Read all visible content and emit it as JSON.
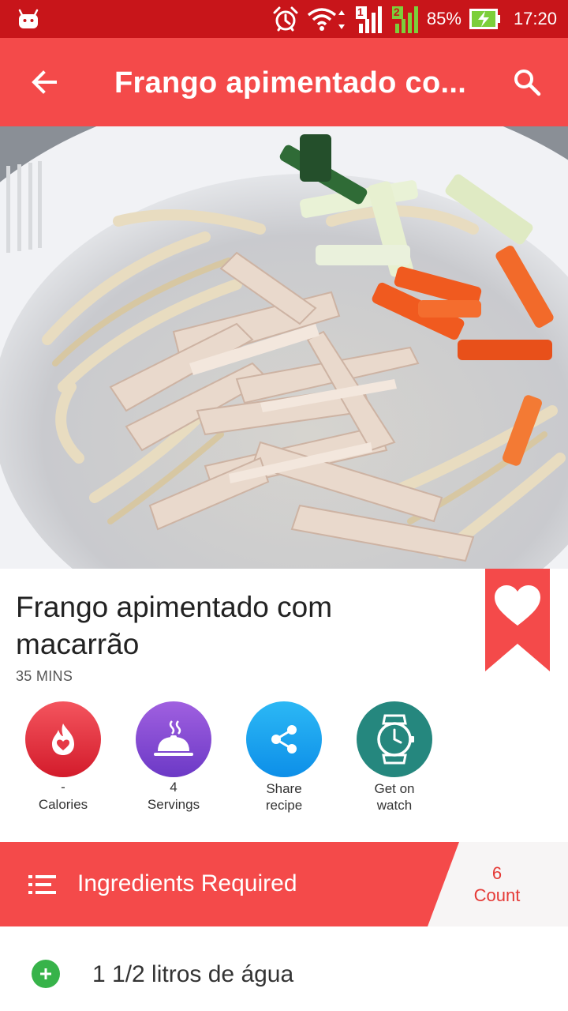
{
  "status_bar": {
    "battery": "85%",
    "time": "17:20",
    "sim1": "1",
    "sim2": "2"
  },
  "app_bar": {
    "title": "Frango apimentado co...",
    "back_icon": "arrow-back-icon",
    "search_icon": "search-icon"
  },
  "recipe": {
    "title": "Frango apimentado com macarrão",
    "time": "35 MINS",
    "favorite_icon": "heart-icon"
  },
  "info": [
    {
      "icon": "flame-heart-icon",
      "value": "-",
      "label": "Calories",
      "color": "#e53945"
    },
    {
      "icon": "cloche-icon",
      "value": "4",
      "label": "Servings",
      "color": "#7d45d0"
    },
    {
      "icon": "share-icon",
      "value": "",
      "label": "Share\nrecipe",
      "color": "#14a0ee"
    },
    {
      "icon": "watch-icon",
      "value": "",
      "label": "Get on\nwatch",
      "color": "#25877e"
    }
  ],
  "ingredients_header": {
    "label": "Ingredients Required",
    "count_value": "6",
    "count_label": "Count"
  },
  "ingredients": [
    {
      "text": "1 1/2 litros de água"
    }
  ],
  "colors": {
    "status_bar": "#c8151a",
    "primary": "#f44a4a",
    "accent_text": "#e53935",
    "add_green": "#37b34a"
  }
}
